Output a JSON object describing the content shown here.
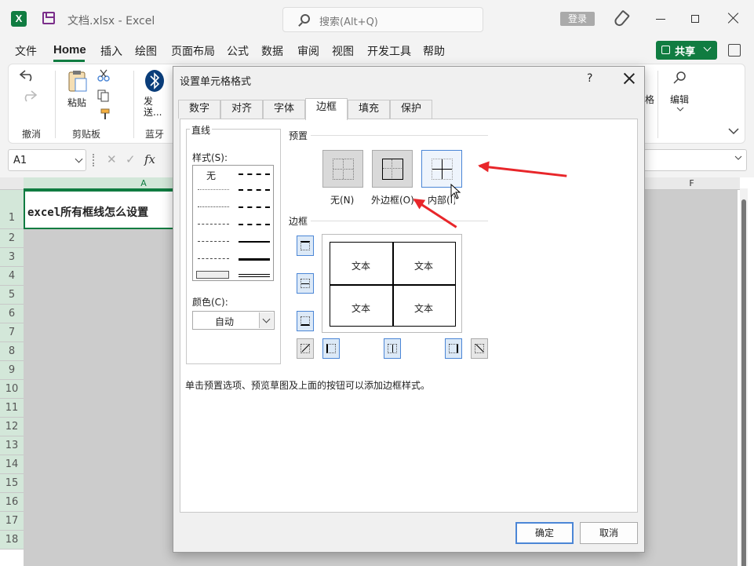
{
  "app": {
    "file_title": "文档.xlsx  -  Excel",
    "logo_letter": "X"
  },
  "search": {
    "placeholder": "搜索(Alt+Q)"
  },
  "titlebar": {
    "login_label": "登录"
  },
  "menu": {
    "items": [
      "文件",
      "Home",
      "插入",
      "绘图",
      "页面布局",
      "公式",
      "数据",
      "审阅",
      "视图",
      "开发工具",
      "帮助"
    ],
    "share_label": "共享"
  },
  "ribbon": {
    "undo_group": "撤消",
    "paste_label": "粘贴",
    "clipboard_group": "剪贴板",
    "send_label": "发送...",
    "bluetooth_group": "蓝牙",
    "edit_label": "编辑",
    "partial_label": "格"
  },
  "formula_bar": {
    "name_box": "A1",
    "fx": "fx"
  },
  "sheet": {
    "columns": [
      "A",
      "F"
    ],
    "rows": [
      "1",
      "2",
      "3",
      "4",
      "5",
      "6",
      "7",
      "8",
      "9",
      "10",
      "11",
      "12",
      "13",
      "14",
      "15",
      "16",
      "17",
      "18"
    ],
    "a1_value": "excel所有框线怎么设置"
  },
  "dialog": {
    "title": "设置单元格格式",
    "help": "?",
    "tabs": [
      "数字",
      "对齐",
      "字体",
      "边框",
      "填充",
      "保护"
    ],
    "active_tab": "边框",
    "line_group": "直线",
    "style_label": "样式(S):",
    "none_style": "无",
    "color_label": "颜色(C):",
    "color_value": "自动",
    "presets_label": "预置",
    "presets": [
      "无(N)",
      "外边框(O)",
      "内部(I)"
    ],
    "border_label": "边框",
    "preview_text": [
      "文本",
      "文本",
      "文本",
      "文本"
    ],
    "hint": "单击预置选项、预览草图及上面的按钮可以添加边框样式。",
    "ok": "确定",
    "cancel": "取消"
  },
  "colors": {
    "excel_green": "#107c41",
    "accent_blue": "#4b86d6",
    "arrow_red": "#e8262a"
  }
}
